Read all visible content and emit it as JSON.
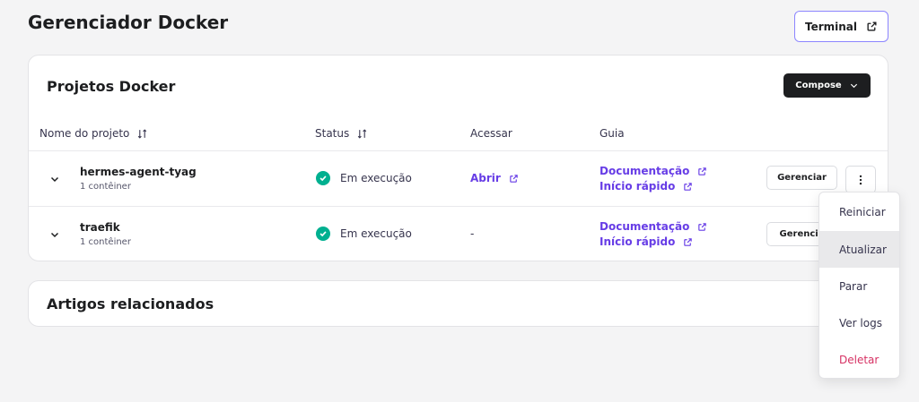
{
  "page": {
    "title": "Gerenciador Docker"
  },
  "header": {
    "terminal_label": "Terminal"
  },
  "projects_card": {
    "title": "Projetos Docker",
    "compose_label": "Compose",
    "columns": {
      "name": "Nome do projeto",
      "status": "Status",
      "access": "Acessar",
      "guide": "Guia"
    },
    "rows": [
      {
        "name": "hermes-agent-tyag",
        "containers": "1 contêiner",
        "status": "Em execução",
        "access": "Abrir",
        "guide_docs": "Documentação",
        "guide_quickstart": "Início rápido",
        "manage": "Gerenciar"
      },
      {
        "name": "traefik",
        "containers": "1 contêiner",
        "status": "Em execução",
        "access": "-",
        "guide_docs": "Documentação",
        "guide_quickstart": "Início rápido",
        "manage": "Gerencia"
      }
    ]
  },
  "related_card": {
    "title": "Artigos relacionados"
  },
  "context_menu": {
    "items": [
      "Reiniciar",
      "Atualizar",
      "Parar",
      "Ver logs",
      "Deletar"
    ],
    "active_item": "Atualizar",
    "danger_item": "Deletar"
  },
  "colors": {
    "accent": "#673de6",
    "status_ok": "#00b090",
    "danger": "#d63163",
    "terminal_border": "#8c85ff",
    "dark_button": "#1d1e20"
  },
  "icons": {
    "external": "external-link-icon",
    "chevron": "chevron-down-icon",
    "sort": "sort-icon",
    "status": "check-circle-icon",
    "more": "more-vertical-icon"
  }
}
